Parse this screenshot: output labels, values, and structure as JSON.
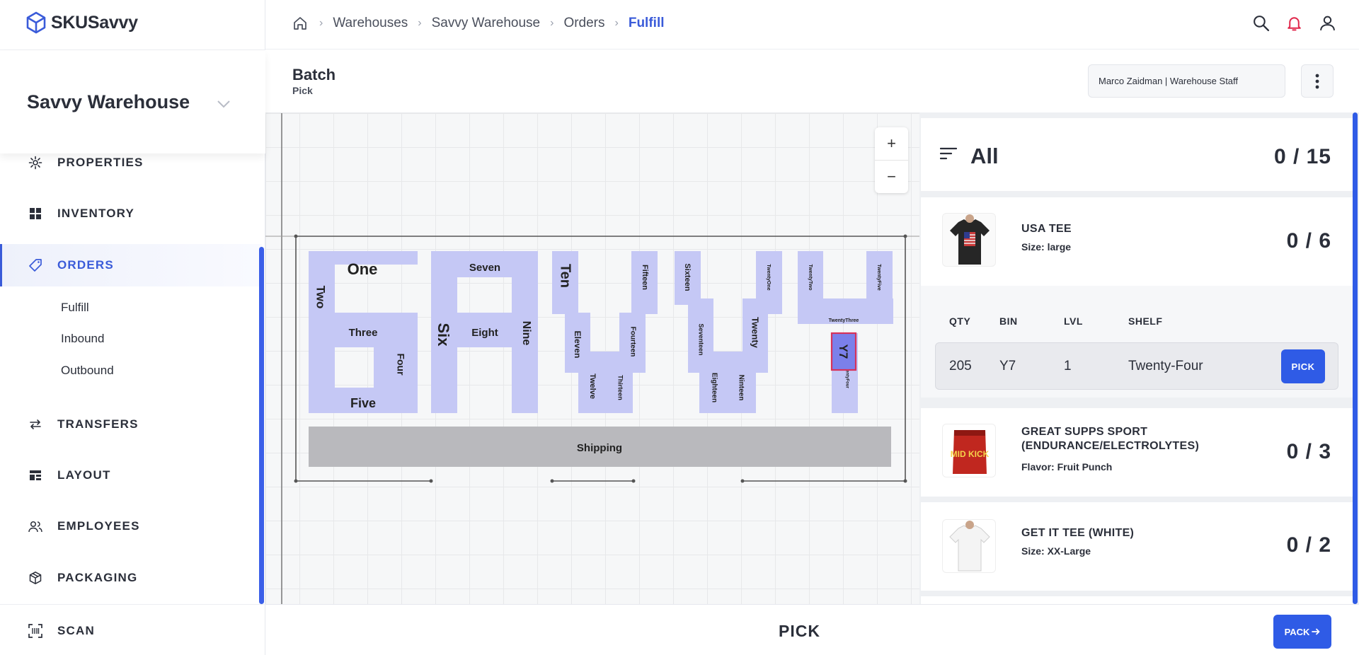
{
  "app": {
    "logo_text": "SKUSavvy"
  },
  "sidebar": {
    "warehouse": "Savvy Warehouse",
    "items": [
      {
        "label": "PROPERTIES",
        "icon": "gear-icon"
      },
      {
        "label": "INVENTORY",
        "icon": "grid-icon"
      },
      {
        "label": "ORDERS",
        "icon": "tag-icon"
      },
      {
        "label": "TRANSFERS",
        "icon": "transfer-icon"
      },
      {
        "label": "LAYOUT",
        "icon": "layout-icon"
      },
      {
        "label": "EMPLOYEES",
        "icon": "users-icon"
      },
      {
        "label": "PACKAGING",
        "icon": "box-icon"
      }
    ],
    "sub_items": [
      "Fulfill",
      "Inbound",
      "Outbound"
    ],
    "scan": "SCAN"
  },
  "breadcrumb": [
    "Warehouses",
    "Savvy Warehouse",
    "Orders",
    "Fulfill"
  ],
  "batch": {
    "title": "Batch",
    "subtitle": "Pick"
  },
  "staff": "Marco Zaidman | Warehouse Staff",
  "map": {
    "zones": [
      "One",
      "Two",
      "Three",
      "Four",
      "Five",
      "Six",
      "Seven",
      "Eight",
      "Nine",
      "Ten",
      "Eleven",
      "Twelve",
      "Thirteen",
      "Fourteen",
      "Fifteen",
      "Sixteen",
      "Seventeen",
      "Eighteen",
      "Ninteen",
      "Twenty",
      "TwentyOne",
      "TwentyTwo",
      "TwentyThree",
      "TwentyFour",
      "TwentyFive"
    ],
    "shipping": "Shipping",
    "highlight_bin": "Y7",
    "zoom_in": "+",
    "zoom_out": "−"
  },
  "panel": {
    "filter_title": "All",
    "total": "0 / 15",
    "items": [
      {
        "name": "USA TEE",
        "attr_label": "Size:",
        "attr_value": "large",
        "count": "0 / 6"
      },
      {
        "name": "GREAT SUPPS SPORT (ENDURANCE/ELECTROLYTES)",
        "attr_label": "Flavor:",
        "attr_value": "Fruit Punch",
        "count": "0 / 3"
      },
      {
        "name": "GET IT TEE (WHITE)",
        "attr_label": "Size:",
        "attr_value": "XX-Large",
        "count": "0 / 2"
      }
    ],
    "bin_headers": [
      "QTY",
      "BIN",
      "LVL",
      "SHELF"
    ],
    "bin_row": {
      "qty": "205",
      "bin": "Y7",
      "lvl": "1",
      "shelf": "Twenty-Four"
    },
    "pick_button": "PICK",
    "thumb_text": "MID KICK"
  },
  "footer": {
    "label": "PICK",
    "pack_button": "PACK"
  },
  "colors": {
    "accent": "#2f5be6",
    "zone": "#c5c8f5",
    "shipping": "#b9b9bd",
    "highlight": "#d6325a",
    "bell": "#e0264a"
  }
}
